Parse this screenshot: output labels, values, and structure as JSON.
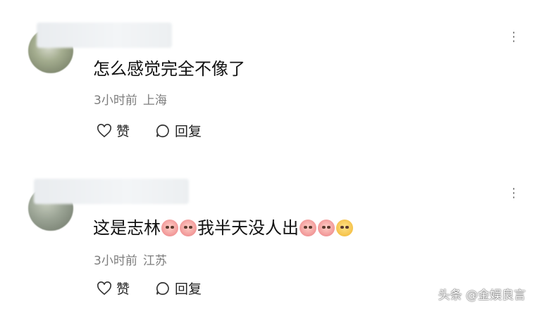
{
  "comments": [
    {
      "text": "怎么感觉完全不像了",
      "time": "3小时前",
      "location": "上海",
      "like_label": "赞",
      "reply_label": "回复",
      "more_icon": "more-horizontal-icon"
    },
    {
      "text_part1": "这是志林",
      "text_part2": "我半天没人出",
      "emojis": [
        "crying-face-emoji",
        "crying-face-emoji",
        "crying-face-emoji",
        "crying-face-emoji",
        "smirk-face-emoji"
      ],
      "time": "3小时前",
      "location": "江苏",
      "like_label": "赞",
      "reply_label": "回复",
      "more_icon": "more-horizontal-icon"
    }
  ],
  "watermark": "头条 @金娱良言"
}
